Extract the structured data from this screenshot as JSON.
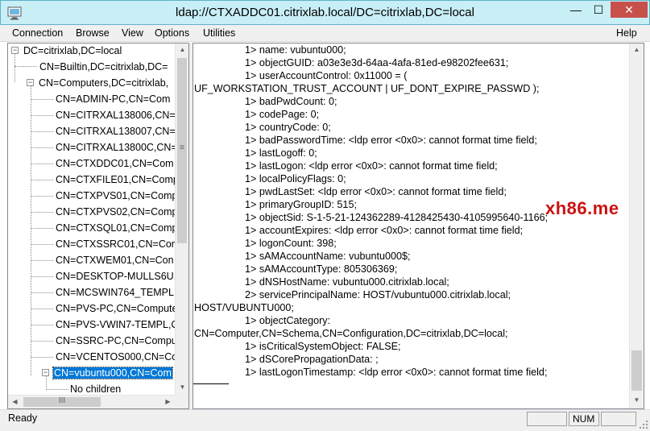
{
  "window": {
    "title": "ldap://CTXADDC01.citrixlab.local/DC=citrixlab,DC=local",
    "min_glyph": "—",
    "max_glyph": "☐",
    "close_glyph": "✕"
  },
  "menu": {
    "items": [
      "Connection",
      "Browse",
      "View",
      "Options",
      "Utilities"
    ],
    "help": "Help"
  },
  "tree": {
    "root": "DC=citrixlab,DC=local",
    "level1": [
      "CN=Builtin,DC=citrixlab,DC=",
      "CN=Computers,DC=citrixlab,"
    ],
    "computers": [
      "CN=ADMIN-PC,CN=Com",
      "CN=CITRXAL138006,CN=",
      "CN=CITRXAL138007,CN=",
      "CN=CITRXAL13800C,CN=",
      "CN=CTXDDC01,CN=Com",
      "CN=CTXFILE01,CN=Comp",
      "CN=CTXPVS01,CN=Comp",
      "CN=CTXPVS02,CN=Comp",
      "CN=CTXSQL01,CN=Comp",
      "CN=CTXSSRC01,CN=Com",
      "CN=CTXWEM01,CN=Con",
      "CN=DESKTOP-MULLS6U,",
      "CN=MCSWIN764_TEMPL,",
      "CN=PVS-PC,CN=Compute",
      "CN=PVS-VWIN7-TEMPL,C",
      "CN=SSRC-PC,CN=Compu",
      "CN=VCENTOS000,CN=Co",
      "CN=vubuntu000,CN=Com"
    ],
    "child": "No children",
    "expander_minus": "−",
    "hscroll_thumb_glyph": "III",
    "vscroll_thumb_glyph": "≡"
  },
  "details": [
    {
      "text": "1> name: vubuntu000;",
      "indent": true
    },
    {
      "text": "1> objectGUID: a03e3e3d-64aa-4afa-81ed-e98202fee631;",
      "indent": true
    },
    {
      "text": "1> userAccountControl: 0x11000 = (",
      "indent": true
    },
    {
      "text": "UF_WORKSTATION_TRUST_ACCOUNT | UF_DONT_EXPIRE_PASSWD );",
      "indent": false
    },
    {
      "text": "1> badPwdCount: 0;",
      "indent": true
    },
    {
      "text": "1> codePage: 0;",
      "indent": true
    },
    {
      "text": "1> countryCode: 0;",
      "indent": true
    },
    {
      "text": "1> badPasswordTime: <ldp error <0x0>: cannot format time field;",
      "indent": true
    },
    {
      "text": "1> lastLogoff: 0;",
      "indent": true
    },
    {
      "text": "1> lastLogon: <ldp error <0x0>: cannot format time field;",
      "indent": true
    },
    {
      "text": "1> localPolicyFlags: 0;",
      "indent": true
    },
    {
      "text": "1> pwdLastSet: <ldp error <0x0>: cannot format time field;",
      "indent": true
    },
    {
      "text": "1> primaryGroupID: 515;",
      "indent": true
    },
    {
      "text": "1> objectSid: S-1-5-21-124362289-4128425430-4105995640-1166;",
      "indent": true
    },
    {
      "text": "1> accountExpires: <ldp error <0x0>: cannot format time field;",
      "indent": true
    },
    {
      "text": "1> logonCount: 398;",
      "indent": true
    },
    {
      "text": "1> sAMAccountName: vubuntu000$;",
      "indent": true
    },
    {
      "text": "1> sAMAccountType: 805306369;",
      "indent": true
    },
    {
      "text": "1> dNSHostName: vubuntu000.citrixlab.local;",
      "indent": true
    },
    {
      "text": "2> servicePrincipalName: HOST/vubuntu000.citrixlab.local;",
      "indent": true
    },
    {
      "text": "HOST/VUBUNTU000;",
      "indent": false
    },
    {
      "text": "1> objectCategory:",
      "indent": true
    },
    {
      "text": "CN=Computer,CN=Schema,CN=Configuration,DC=citrixlab,DC=local;",
      "indent": false
    },
    {
      "text": "1> isCriticalSystemObject: FALSE;",
      "indent": true
    },
    {
      "text": "1> dSCorePropagationData: ;",
      "indent": true
    },
    {
      "text": "1> lastLogonTimestamp: <ldp error <0x0>: cannot format time field;",
      "indent": true
    }
  ],
  "status": {
    "text": "Ready",
    "num": "NUM"
  },
  "watermark": "xh86.me"
}
